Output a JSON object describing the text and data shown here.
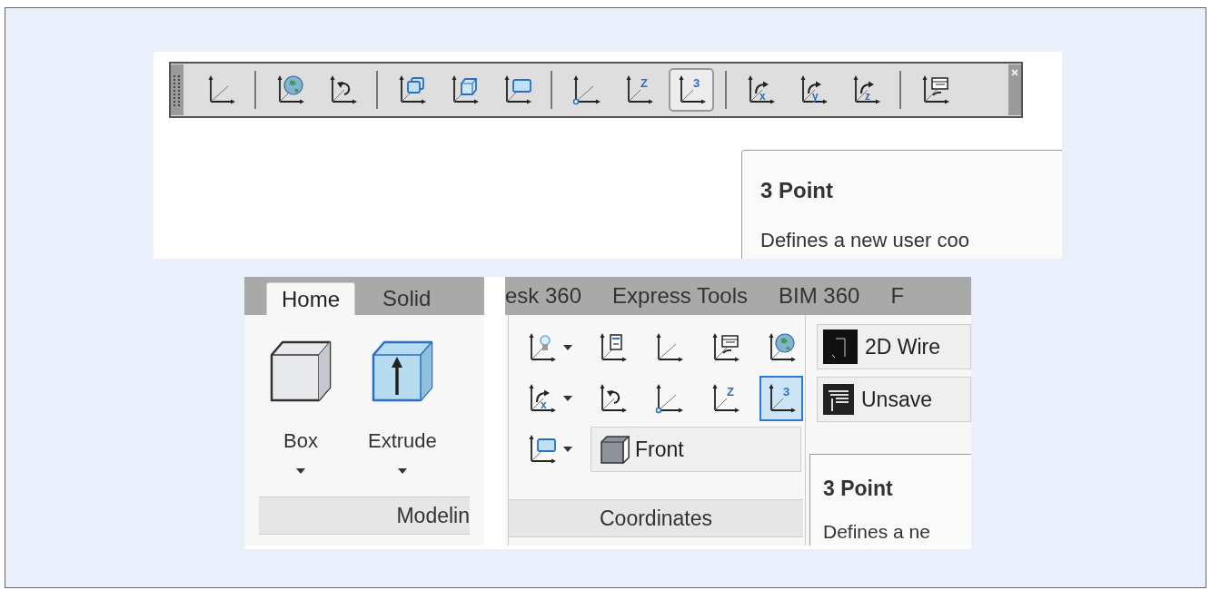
{
  "top_capture": {
    "toolbar": {
      "groups": [
        [
          {
            "kind": "world",
            "selected": false
          }
        ],
        [
          {
            "kind": "globe",
            "selected": false
          },
          {
            "kind": "previous",
            "selected": false
          }
        ],
        [
          {
            "kind": "face",
            "selected": false
          },
          {
            "kind": "object",
            "selected": false
          },
          {
            "kind": "view",
            "selected": false
          }
        ],
        [
          {
            "kind": "origin",
            "selected": false
          },
          {
            "kind": "axis",
            "badge": "Z",
            "selected": false
          },
          {
            "kind": "axis",
            "badge": "3",
            "selected": true
          }
        ],
        [
          {
            "kind": "rotate",
            "badge": "x",
            "selected": false
          },
          {
            "kind": "rotate",
            "badge": "y",
            "selected": false
          },
          {
            "kind": "rotate",
            "badge": "z",
            "selected": false
          }
        ],
        [
          {
            "kind": "named",
            "selected": false
          }
        ]
      ]
    },
    "tooltip": {
      "title": "3 Point",
      "description": "Defines a new user coo"
    }
  },
  "bottom_capture": {
    "tabs": [
      {
        "label": "Home",
        "selected": true
      },
      {
        "label": "Solid",
        "selected": false
      }
    ],
    "tabs_continued": [
      {
        "label": "esk 360",
        "selected": false
      },
      {
        "label": "Express Tools",
        "selected": false
      },
      {
        "label": "BIM 360",
        "selected": false
      },
      {
        "label": "F",
        "selected": false
      }
    ],
    "modeling_panel": {
      "buttons": [
        {
          "label": "Box",
          "kind": "box"
        },
        {
          "label": "Extrude",
          "kind": "extrude"
        }
      ],
      "title": "Modelin"
    },
    "coordinates_panel": {
      "rows": [
        [
          {
            "kind": "light",
            "dropdown": true,
            "selected": false
          },
          {
            "kind": "properties",
            "dropdown": false,
            "selected": false
          },
          {
            "kind": "world",
            "dropdown": false,
            "selected": false
          },
          {
            "kind": "named",
            "dropdown": false,
            "selected": false
          },
          {
            "kind": "globe",
            "dropdown": false,
            "selected": false
          }
        ],
        [
          {
            "kind": "rotate",
            "badge": "x",
            "dropdown": true,
            "selected": false
          },
          {
            "kind": "previous",
            "dropdown": false,
            "selected": false
          },
          {
            "kind": "origin",
            "dropdown": false,
            "selected": false
          },
          {
            "kind": "axis",
            "badge": "Z",
            "dropdown": false,
            "selected": false
          },
          {
            "kind": "axis",
            "badge": "3",
            "dropdown": false,
            "selected": true
          }
        ],
        [
          {
            "kind": "view",
            "dropdown": true,
            "selected": false
          },
          {
            "kind": "combo",
            "label": "Front"
          }
        ]
      ],
      "title": "Coordinates"
    },
    "visual_buttons": [
      {
        "label": "2D Wire",
        "kind": "wireframe"
      },
      {
        "label": "Unsave",
        "kind": "saved-view"
      }
    ],
    "tooltip": {
      "title": "3 Point",
      "description": "Defines a ne"
    }
  }
}
